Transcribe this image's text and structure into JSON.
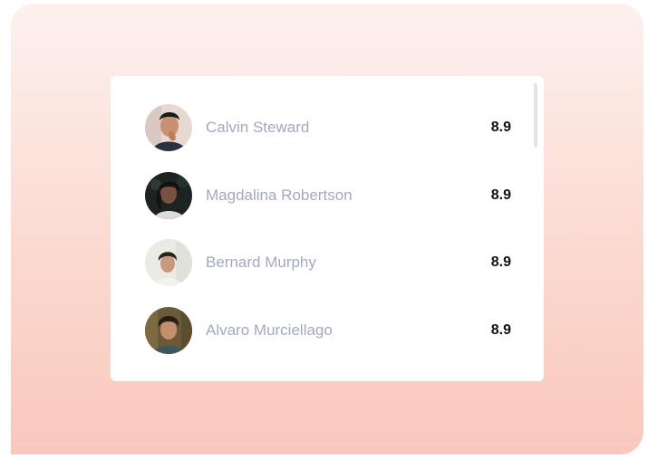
{
  "leaderboard": {
    "items": [
      {
        "name": "Calvin Steward",
        "score": "8.9",
        "avatar": "person-portrait-icon"
      },
      {
        "name": "Magdalina Robertson",
        "score": "8.9",
        "avatar": "person-portrait-icon"
      },
      {
        "name": "Bernard Murphy",
        "score": "8.9",
        "avatar": "person-portrait-icon"
      },
      {
        "name": "Alvaro Murciellago",
        "score": "8.9",
        "avatar": "person-portrait-icon"
      }
    ],
    "scroll_position": 0
  },
  "colors": {
    "background_top": "#fdf1ee",
    "background_bottom": "#f9c8bc",
    "card": "#ffffff",
    "name_text": "#a3a9bf",
    "score_text": "#111111",
    "scrollbar_thumb": "#e3e3ea"
  }
}
